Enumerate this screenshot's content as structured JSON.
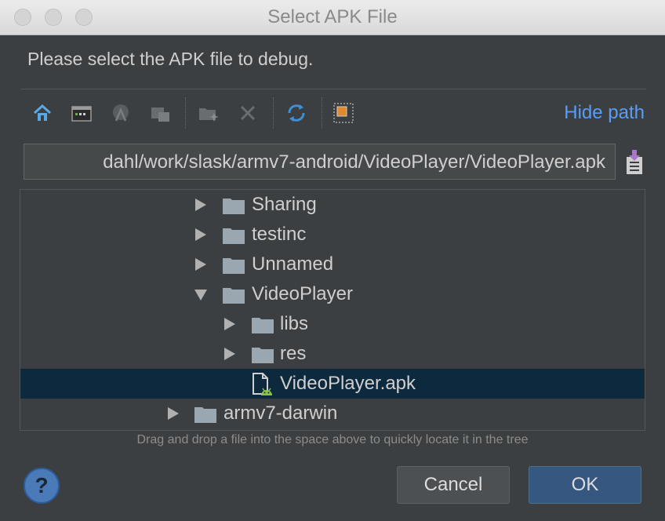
{
  "window": {
    "title": "Select APK File"
  },
  "prompt": "Please select the APK file to debug.",
  "toolbar": {
    "icons": [
      "home-icon",
      "desktop-icon",
      "android-project-icon",
      "module-folder-icon",
      "new-folder-icon",
      "delete-icon",
      "refresh-icon",
      "show-hidden-icon"
    ],
    "hide_path_label": "Hide path"
  },
  "path": {
    "value": "dahl/work/slask/armv7-android/VideoPlayer/VideoPlayer.apk"
  },
  "tree": {
    "rows": [
      {
        "label": "Sharing",
        "type": "folder",
        "expanded": false,
        "depth": 2
      },
      {
        "label": "testinc",
        "type": "folder",
        "expanded": false,
        "depth": 2
      },
      {
        "label": "Unnamed",
        "type": "folder",
        "expanded": false,
        "depth": 2
      },
      {
        "label": "VideoPlayer",
        "type": "folder",
        "expanded": true,
        "depth": 2
      },
      {
        "label": "libs",
        "type": "folder",
        "expanded": false,
        "depth": 3
      },
      {
        "label": "res",
        "type": "folder",
        "expanded": false,
        "depth": 3
      },
      {
        "label": "VideoPlayer.apk",
        "type": "apk",
        "selected": true,
        "depth": 3
      },
      {
        "label": "armv7-darwin",
        "type": "folder",
        "expanded": false,
        "depth": 1
      }
    ]
  },
  "hint": "Drag and drop a file into the space above to quickly locate it in the tree",
  "buttons": {
    "help": "?",
    "cancel": "Cancel",
    "ok": "OK"
  },
  "colors": {
    "accent": "#589df6",
    "selection": "#0d293e",
    "background": "#3c3f41"
  }
}
